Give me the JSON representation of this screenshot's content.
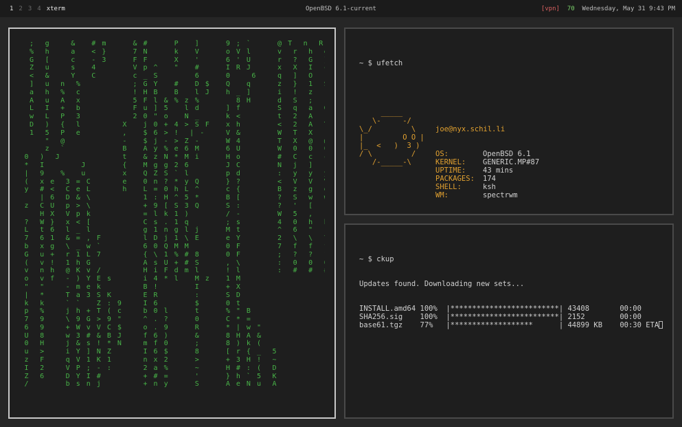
{
  "statusbar": {
    "workspaces": [
      "1",
      "2",
      "3",
      "4"
    ],
    "active_workspace": "1",
    "window_name": "xterm",
    "title": "OpenBSD 6.1-current",
    "vpn": "[vpn]",
    "number": "70",
    "datetime": "Wednesday, May 31  9:43 PM"
  },
  "ufetch": {
    "prompt1": "~ $ ufetch",
    "user_host": "joe@nyx.schil.li",
    "logo": [
      "     _____",
      "   \\-     -/",
      "\\_/         \\",
      "|         O O |",
      "|_  <   )  3 )",
      "/ \\         /",
      "   /-_____-\\"
    ],
    "fields": [
      {
        "label": "OS:",
        "value": "OpenBSD 6.1"
      },
      {
        "label": "KERNEL:",
        "value": "GENERIC.MP#87"
      },
      {
        "label": "UPTIME:",
        "value": "43 mins"
      },
      {
        "label": "PACKAGES:",
        "value": "174"
      },
      {
        "label": "SHELL:",
        "value": "ksh"
      },
      {
        "label": "WM:",
        "value": "spectrwm"
      }
    ],
    "prompt2": "~ $ "
  },
  "ckup": {
    "prompt": "~ $ ckup",
    "message": "Updates found. Downloading new sets...",
    "rows": [
      {
        "file": "INSTALL.amd64",
        "pct": "100%",
        "bar": "|*************************|",
        "size": "43408",
        "time": "00:00"
      },
      {
        "file": "SHA256.sig",
        "pct": "100%",
        "bar": "|*************************|",
        "size": "2152",
        "time": "00:00"
      },
      {
        "file": "base61.tgz",
        "pct": "77%",
        "bar": "|*******************      |",
        "size": "44899 KB",
        "time": "00:30 ETA"
      }
    ]
  },
  "matrix": {
    "lines": [
      "  ;  g    &   # m     & #     P   ]     9 ; `     @ T  n  R",
      "  %  h    a   < }     7 N     k   V     o V l     v  r  h  e",
      "  G  [    c   - 3     F F     X   '     6 ' U     r  ?  G  }",
      "  Z  u    s   4       V p ^   \"   #     I R J     x  X  I  c",
      "  <  &    Y   C       c _ S       6     0    6    q  ]  O  -",
      "  ]  u  n  %          ; G Y   #   D $   Q   q     z  }  1  S",
      "  a  h  %  c          ! H B   B   l J   h _ ]     i  !  z  (",
      "  A  u  A  x          5 F l & % z %       8 H     d  S  ;  [",
      "  L  I  +  b          F u ] 5   l d     ] f       S  q  a  G",
      "  w  L  P  3          2 0 \" o   N _     k <       t  2  A  ;",
      "  D  )  {  l        X   j 0 + 4 > S F   x h       <  2  A  T",
      "  1  5  P  e        ,   $ 6 > !  | -    V &       W  T  X  `",
      "     \"  @           -   $ j - > Z -     W 4       T  X  @  @",
      "     z  `           B   A y % e 6 M     6 U       W  0  0  0",
      " 0  )  J            t   & z N * M i     H o       #  C  c  c",
      " *  I       J       {   M g g 2 6       J C       N  j  ]  ]",
      " |  9   %   u       x   Q Z S ` l       p d       :  y  y  y",
      " (  x e  3 = C      e   0 n ? * y Q     } ?       <  V  V  V",
      " y  # <  C e L      h   L = 0 h L ^     c {       B  z  g  g",
      "    | 6  D & \\          1 : H ^ 5 *     B [       ?  S  w  w",
      " z  C U  p > \\          + 9 [ S 3 Q     S :       ?  '  [  [",
      "    H X  V p k          = l k 1 )       / -       W  5  ,  ,",
      " ?  W }  x < [          C s . 1 q       ; s       4  0  h  h",
      " L  t 6  l _ l          g 1 n g l j     M t       ^  6  \"  \"",
      " 7  6 1  & = , F        l D j 1 \\ E     e Y       2  \\  \\  \\",
      " b  x g  \\ _ w `        6 0 Q M M       0 F       7  f  f  f",
      " G  u +  r 1 L 7        { \\ 1 % # 8     0 F       ;  ?  ?  ?",
      " (  v !  1 h G          A s U + # S     , \\       :  0  0  0",
      " v  n h  @ K v /        H i F d m l     ! l       :  #  #  #",
      " o  v f  - ) Y E s      i 4 * l   M z   1 M",
      " \"  \"    - m e k        B !       I     + X",
      " |  *    T a 3 S K      E R       :     S D",
      " k  k    ` `   Z : 9    I 6       $     0 t",
      " p  %    j h + T ( c    b 0 l     t     % \" B",
      " 7  9    \\ 9 G > 9 \"    ^ . ?     0     C * =",
      " 6  9    + W v V C $    o . 9     R     * | w \"",
      " U  8    w 3 # & B J    f 6 )     &     8 H A &",
      " 0  H    j & s ! * N    m f 0     ;     8 ) k (",
      " u  >    i Y ] N Z      I 6 $     8     [ r { _  5",
      " z  F    q V 1 K 1      n x 2     >     + 3 H !  ~",
      " I  2    V P ; - :      2 a %     ~     H # : (  D",
      " Z  6    D Y I #        + # =     '     } h ` 5  K",
      " /       b s n j        + n y     S     A e N u  A"
    ]
  }
}
